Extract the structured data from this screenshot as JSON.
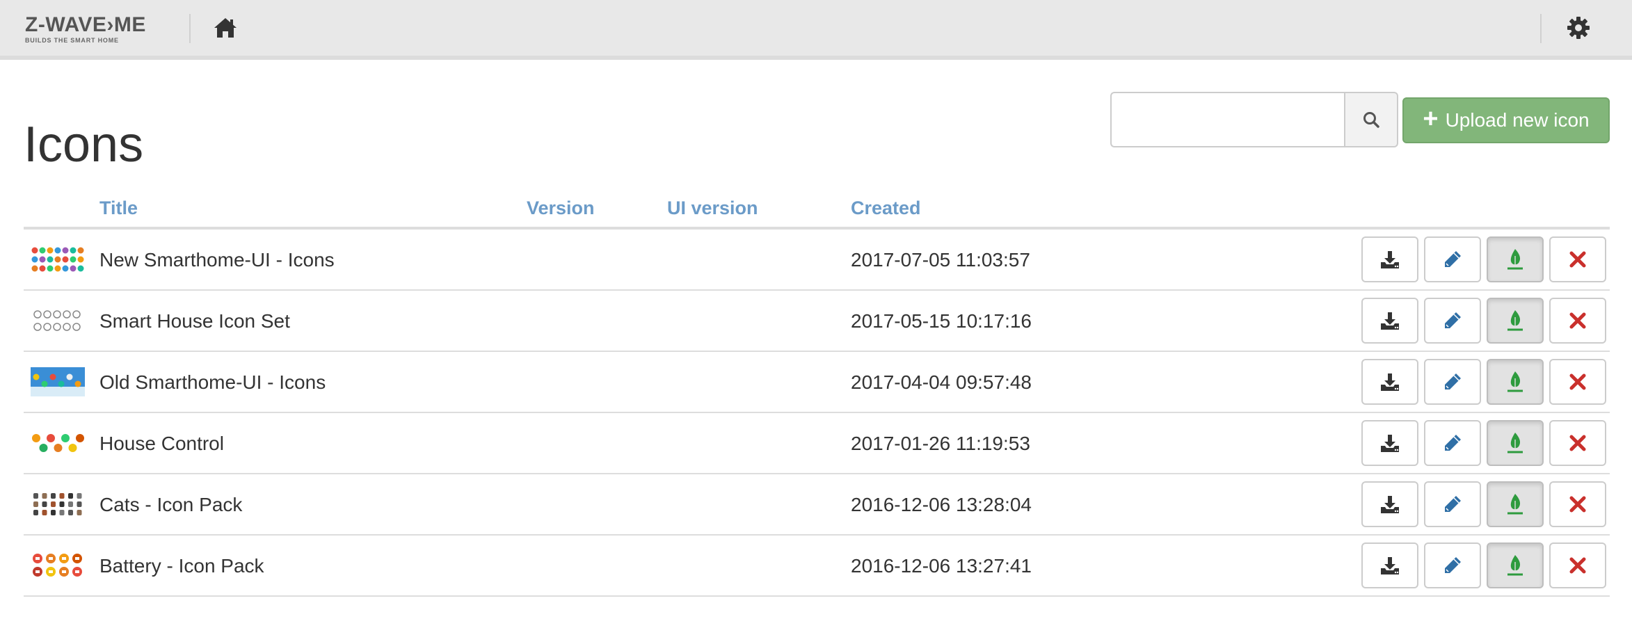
{
  "navbar": {
    "brand": "Z-WAVE›ME",
    "brand_tagline": "BUILDS THE SMART HOME",
    "home_icon": "home-icon",
    "settings_icon": "gear-icon"
  },
  "page": {
    "title": "Icons"
  },
  "search": {
    "value": "",
    "placeholder": "",
    "icon": "search-icon"
  },
  "upload_button": {
    "label": "Upload new icon",
    "icon": "plus-icon",
    "color": "#82b67a"
  },
  "table": {
    "columns": [
      "Title",
      "Version",
      "UI version",
      "Created"
    ],
    "header_color": "#6b9bc8",
    "rows": [
      {
        "title": "New Smarthome-UI - Icons",
        "version": "",
        "ui_version": "",
        "created": "2017-07-05 11:03:57",
        "thumb": "colorful-dot-grid"
      },
      {
        "title": "Smart House Icon Set",
        "version": "",
        "ui_version": "",
        "created": "2017-05-15 10:17:16",
        "thumb": "gray-line-icons"
      },
      {
        "title": "Old Smarthome-UI - Icons",
        "version": "",
        "ui_version": "",
        "created": "2017-04-04 09:57:48",
        "thumb": "blue-banner"
      },
      {
        "title": "House Control",
        "version": "",
        "ui_version": "",
        "created": "2017-01-26 11:19:53",
        "thumb": "orange-green-spheres"
      },
      {
        "title": "Cats - Icon Pack",
        "version": "",
        "ui_version": "",
        "created": "2016-12-06 13:28:04",
        "thumb": "cat-figures"
      },
      {
        "title": "Battery - Icon Pack",
        "version": "",
        "ui_version": "",
        "created": "2016-12-06 13:27:41",
        "thumb": "battery-circles"
      }
    ],
    "row_actions": [
      {
        "name": "download",
        "icon": "download-icon"
      },
      {
        "name": "edit",
        "icon": "pencil-icon"
      },
      {
        "name": "activate",
        "icon": "leaf-icon",
        "active": true
      },
      {
        "name": "delete",
        "icon": "close-icon",
        "color": "#c9302c"
      }
    ]
  }
}
